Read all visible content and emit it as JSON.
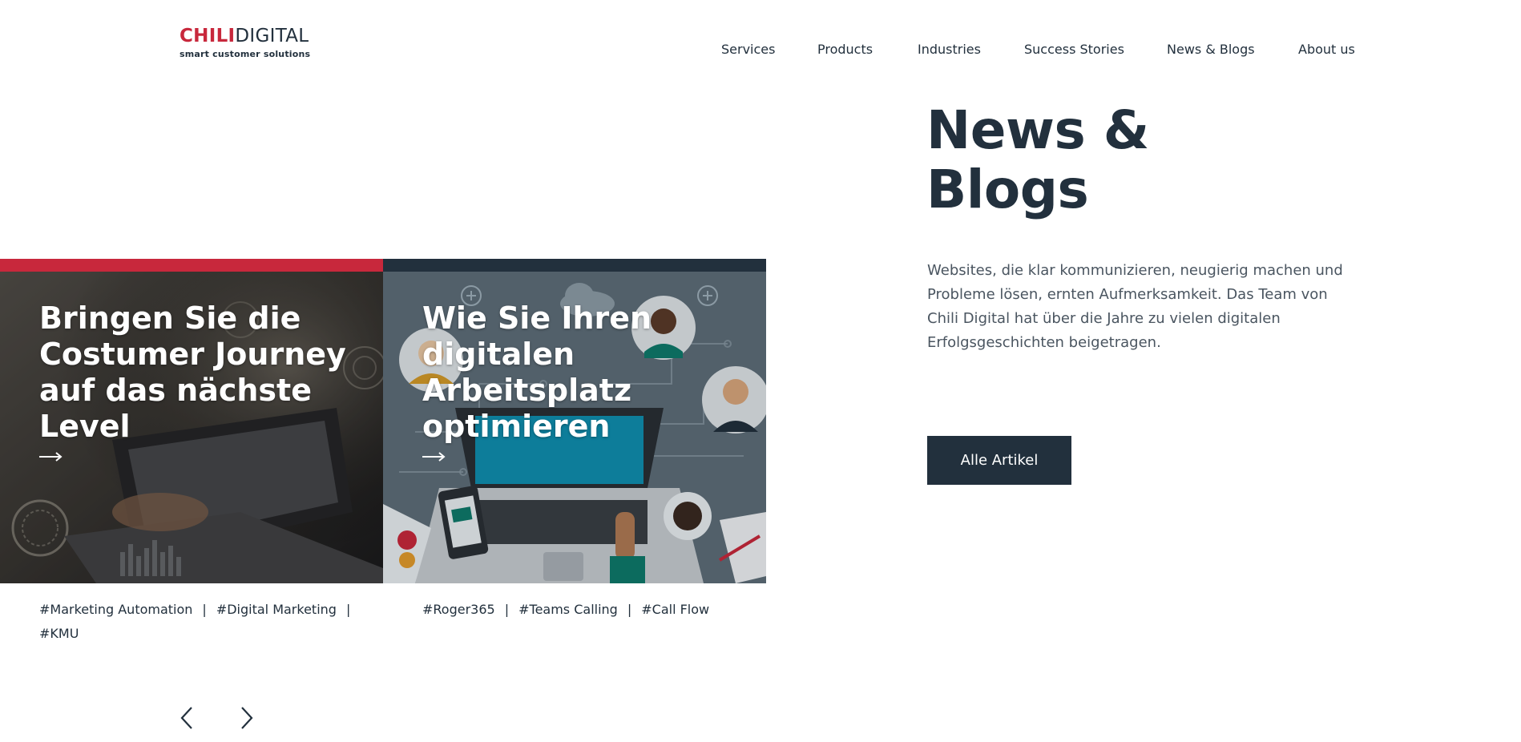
{
  "logo": {
    "chili": "CHILI",
    "digital": "DIGITAL",
    "tagline": "smart customer solutions"
  },
  "nav": {
    "items": [
      {
        "label": "Services"
      },
      {
        "label": "Products"
      },
      {
        "label": "Industries"
      },
      {
        "label": "Success Stories"
      },
      {
        "label": "News & Blogs"
      },
      {
        "label": "About us"
      }
    ]
  },
  "hero": {
    "title": "News & Blogs",
    "intro": "Websites, die klar kommunizieren, neugierig machen und Probleme lösen, ernten Aufmerksamkeit. Das Team von Chili Digital hat über die Jahre zu vielen digitalen Erfolgsgeschichten beigetragen.",
    "cta_label": "Alle Artikel"
  },
  "articles": [
    {
      "title": "Bringen Sie die Costumer Journey auf das nächste Level",
      "accent_color": "#c8283c",
      "tags": [
        "#Marketing Automation",
        "#Digital Marketing",
        "#KMU"
      ]
    },
    {
      "title": "Wie Sie Ihren digitalen Arbeitsplatz optimieren",
      "accent_color": "#22303d",
      "tags": [
        "#Roger365",
        "#Teams Calling",
        "#Call Flow"
      ]
    }
  ],
  "carousel": {
    "prev_icon": "chevron-left-icon",
    "next_icon": "chevron-right-icon"
  },
  "colors": {
    "brand_red": "#c8283c",
    "brand_dark": "#22303d",
    "text_gray": "#4a5560"
  }
}
